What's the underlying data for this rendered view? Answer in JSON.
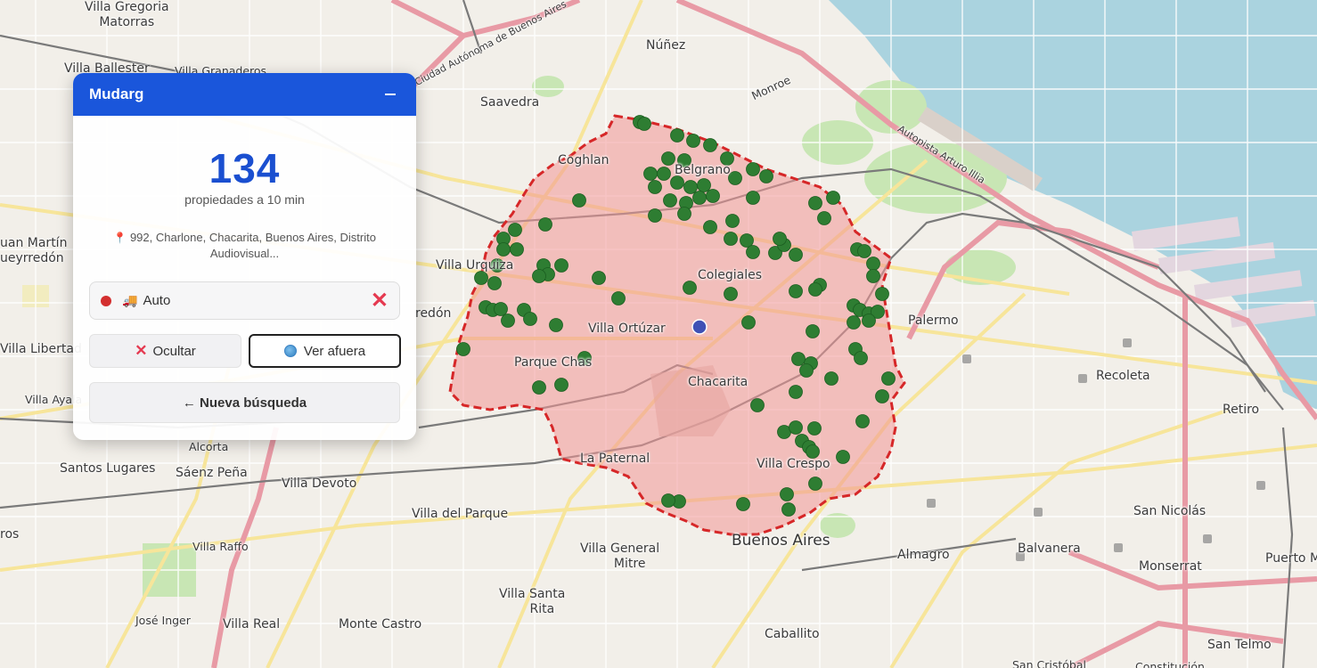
{
  "panel": {
    "title": "Mudarg",
    "count": "134",
    "count_label": "propiedades a 10 min",
    "address": "992, Charlone, Chacarita, Buenos Aires, Distrito Audiovisual...",
    "mode_label": "Auto",
    "hide_label": "Ocultar",
    "outside_label": "Ver afuera",
    "new_search_label": "← Nueva búsqueda"
  },
  "colors": {
    "accent": "#1a56db",
    "count": "#1a4fd0",
    "isochrone_fill": "#f2b8b8",
    "isochrone_stroke": "#d62728",
    "property_dot": "#2e7d32",
    "center_dot": "#3f51b5",
    "water": "#aad3df"
  },
  "map_labels": [
    "Villa Gregoria Matorras",
    "Villa Ballester",
    "Villa Granaderos",
    "Núñez",
    "Saavedra",
    "Coghlan",
    "Belgrano",
    "Juan Martín Pueyrredón",
    "Villa Urquiza",
    "Colegiales",
    "Villa Ortúzar",
    "Parque Chas",
    "Chacarita",
    "Palermo",
    "Recoleta",
    "Retiro",
    "Villa Libertad",
    "Villa Ayala",
    "Alcorta",
    "Santos Lugares",
    "Sáenz Peña",
    "Villa Devoto",
    "La Paternal",
    "Villa Crespo",
    "Villa del Parque",
    "Villa Raffo",
    "Villa General Mitre",
    "Buenos Aires",
    "Almagro",
    "Balvanera",
    "San Nicolás",
    "Monserrat",
    "Puerto Madero",
    "Villa Santa Rita",
    "José Ingenieros",
    "Villa Real",
    "Monte Castro",
    "Caballito",
    "San Telmo",
    "San Cristóbal",
    "Constitución",
    "Monroe",
    "Autopista Arturo Illia",
    "Ciudad Autónoma de Buenos Aires",
    "Ros"
  ]
}
